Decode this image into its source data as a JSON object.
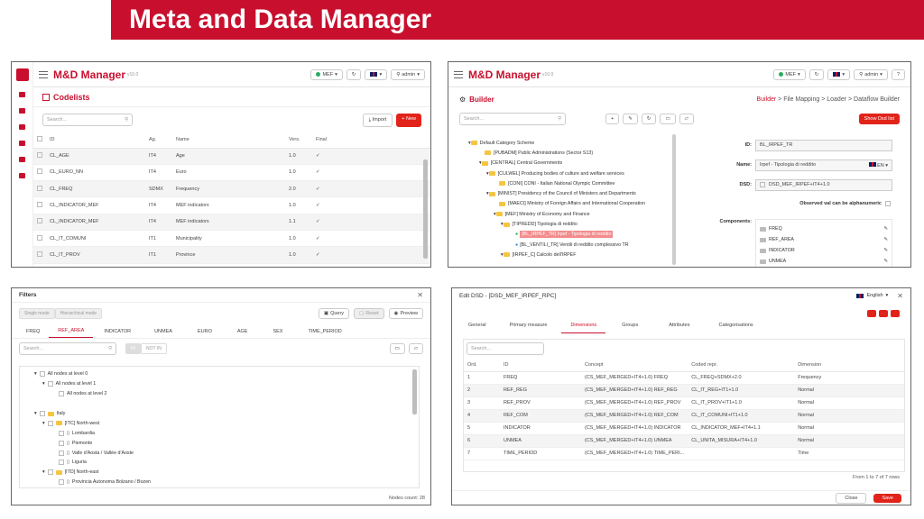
{
  "slide_title": "Meta and Data Manager",
  "colors": {
    "brand": "#c8102e",
    "accent_red": "#e2231a",
    "highlight": "#f28c8c"
  },
  "topbar": {
    "brand": "M&D Manager",
    "version": "v10.0",
    "env": "MEF",
    "lang": "",
    "user": "admin"
  },
  "codelists": {
    "title": "Codelists",
    "search_placeholder": "Search...",
    "import_label": "Import",
    "new_label": "New",
    "columns": [
      "ID",
      "Ag.",
      "Name",
      "Vers.",
      "Final"
    ],
    "rows": [
      {
        "id": "CL_AGE",
        "ag": "IT4",
        "name": "Age",
        "vers": "1.0",
        "final": "✓"
      },
      {
        "id": "CL_EURO_NN",
        "ag": "IT4",
        "name": "Euro",
        "vers": "1.0",
        "final": "✓"
      },
      {
        "id": "CL_FREQ",
        "ag": "SDMX",
        "name": "Frequency",
        "vers": "2.0",
        "final": "✓"
      },
      {
        "id": "CL_INDICATOR_MEF",
        "ag": "IT4",
        "name": "MEF indicators",
        "vers": "1.0",
        "final": "✓"
      },
      {
        "id": "CL_INDICATOR_MEF",
        "ag": "IT4",
        "name": "MEF indicators",
        "vers": "1.1",
        "final": "✓"
      },
      {
        "id": "CL_IT_COMUNI",
        "ag": "IT1",
        "name": "Municipality",
        "vers": "1.0",
        "final": "✓"
      },
      {
        "id": "CL_IT_PROV",
        "ag": "IT1",
        "name": "Province",
        "vers": "1.0",
        "final": "✓"
      }
    ]
  },
  "builder": {
    "title": "Builder",
    "crumbs": [
      "Builder",
      "File Mapping",
      "Loader",
      "Dataflow Builder"
    ],
    "show_dsd": "Show Dsd list",
    "search_placeholder": "Search...",
    "tree": [
      {
        "indent": 0,
        "text": "Default Category Scheme",
        "hl": false
      },
      {
        "indent": 1,
        "text": "[PUBADM] Public Administrations (Sector S13)",
        "hl": false
      },
      {
        "indent": 1,
        "text": "[CENTRAL] Central Governments",
        "hl": false
      },
      {
        "indent": 2,
        "text": "[CULWEL] Producing bodies of culture and welfare services",
        "hl": false
      },
      {
        "indent": 3,
        "text": "[CONI] CONI - Italian National Olympic Committee",
        "hl": false
      },
      {
        "indent": 2,
        "text": "[MINIST] Presidency of the Council of Ministers and Departments",
        "hl": false
      },
      {
        "indent": 3,
        "text": "[MAECI] Ministry of Foreign Affairs and International Cooperation",
        "hl": false
      },
      {
        "indent": 3,
        "text": "[MEF] Ministry of Economy and Finance",
        "hl": false
      },
      {
        "indent": 4,
        "text": "[TIPREDD] Tipologia di reddito",
        "hl": false
      },
      {
        "indent": 5,
        "text": "[BL_IRPEF_TR] Irpef - Tipologia di reddito",
        "hl": true
      },
      {
        "indent": 5,
        "text": "[BL_VENTILI_TR] Ventili di reddito complessivo TR",
        "hl": false
      },
      {
        "indent": 4,
        "text": "[IRPEF_C] Calcolo dell'IRPEF",
        "hl": false
      }
    ],
    "form": {
      "id_label": "ID:",
      "id_value": "BL_IRPEF_TR",
      "name_label": "Name:",
      "name_value": "Irpef - Tipologia di reddito",
      "name_lang": "EN",
      "dsd_label": "DSD:",
      "dsd_value": "DSD_MEF_IRPEF+IT4+1.0",
      "observed_label": "Observed val can be alphanumeric",
      "components_label": "Components:",
      "components": [
        "FREQ",
        "REF_AREA",
        "INDICATOR",
        "UNMEA"
      ]
    }
  },
  "filters": {
    "title": "Filters",
    "mode_tabs": [
      "Single mode",
      "Hierarchical mode"
    ],
    "query": "Query",
    "reset": "Reset",
    "preview": "Preview",
    "dims": [
      "FREQ",
      "REF_AREA",
      "INDICATOR",
      "UNMEA",
      "EURO",
      "AGE",
      "SEX",
      "TIME_PERIOD"
    ],
    "active_dim": "REF_AREA",
    "search_placeholder": "Search...",
    "in_label": "IN",
    "not_in_label": "NOT IN",
    "tree": [
      {
        "indent": 0,
        "text": "All nodes at level 0"
      },
      {
        "indent": 1,
        "text": "All nodes at level 1"
      },
      {
        "indent": 2,
        "text": "All nodes at level 2"
      },
      {
        "indent": 0,
        "text": ""
      },
      {
        "indent": 0,
        "text": "Italy"
      },
      {
        "indent": 1,
        "text": "[ITC] North-west"
      },
      {
        "indent": 2,
        "text": "Lombardia"
      },
      {
        "indent": 2,
        "text": "Piemonte"
      },
      {
        "indent": 2,
        "text": "Valle d'Aosta / Vallée d'Aoste"
      },
      {
        "indent": 2,
        "text": "Liguria"
      },
      {
        "indent": 1,
        "text": "[ITD] North-east"
      },
      {
        "indent": 2,
        "text": "Provincia Autonoma Bolzano / Bozen"
      }
    ],
    "nodes_count": "Nodes count: 28"
  },
  "edit_dsd": {
    "title": "Edit DSD - [DSD_MEF_IRPEF_RPC]",
    "lang": "English",
    "tabs": [
      "General",
      "Primary measure",
      "Dimensions",
      "Groups",
      "Attributes",
      "Categorisations"
    ],
    "active_tab": "Dimensions",
    "search_placeholder": "Search...",
    "columns": [
      "Ord.",
      "ID",
      "Concept",
      "Coded repr.",
      "Dimension"
    ],
    "rows": [
      [
        "1",
        "FREQ",
        "(CS_MEF_MERGED+IT4+1.0) FREQ",
        "CL_FREQ+SDMX+2.0",
        "Frequency"
      ],
      [
        "2",
        "REF_REG",
        "(CS_MEF_MERGED+IT4+1.0) REF_REG",
        "CL_IT_REG+IT1+1.0",
        "Normal"
      ],
      [
        "3",
        "REF_PROV",
        "(CS_MEF_MERGED+IT4+1.0) REF_PROV",
        "CL_IT_PROV+IT1+1.0",
        "Normal"
      ],
      [
        "4",
        "REF_COM",
        "(CS_MEF_MERGED+IT4+1.0) REF_COM",
        "CL_IT_COMUNI+IT1+1.0",
        "Normal"
      ],
      [
        "5",
        "INDICATOR",
        "(CS_MEF_MERGED+IT4+1.0) INDICATOR",
        "CL_INDICATOR_MEF+IT4+1.1",
        "Normal"
      ],
      [
        "6",
        "UNMEA",
        "(CS_MEF_MERGED+IT4+1.0) UNMEA",
        "CL_UNITA_MISURA+IT4+1.0",
        "Normal"
      ],
      [
        "7",
        "TIME_PERIOD",
        "(CS_MEF_MERGED+IT4+1.0) TIME_PERI...",
        "",
        "Time"
      ]
    ],
    "pager": "From 1 to 7 of 7 rows",
    "close": "Close",
    "save": "Save"
  }
}
